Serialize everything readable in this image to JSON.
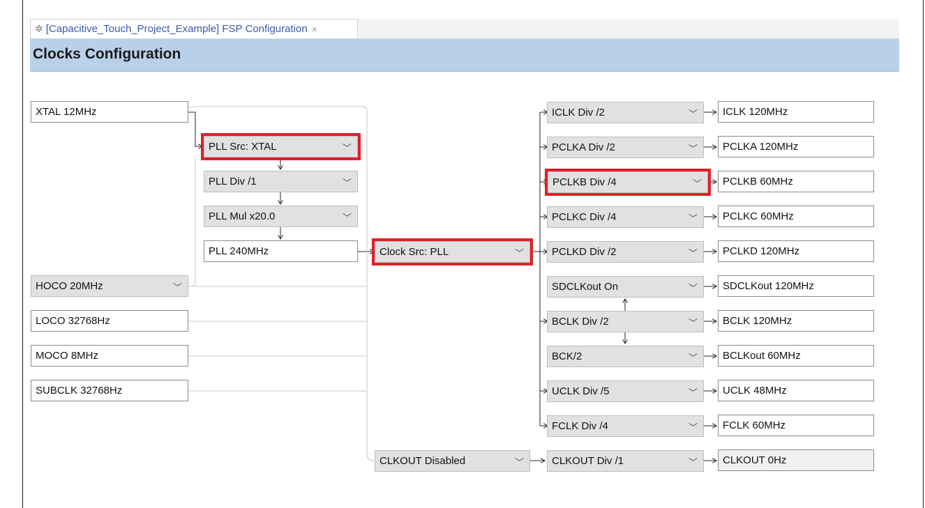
{
  "tab": {
    "title": "[Capacitive_Touch_Project_Example] FSP Configuration",
    "close": "×",
    "icon": "gear-icon"
  },
  "header": {
    "title": "Clocks Configuration"
  },
  "sources": {
    "xtal": "XTAL 12MHz",
    "hoco": "HOCO 20MHz",
    "loco": "LOCO 32768Hz",
    "moco": "MOCO 8MHz",
    "subclk": "SUBCLK 32768Hz"
  },
  "pll": {
    "src": "PLL Src: XTAL",
    "div": "PLL Div /1",
    "mul": "PLL Mul x20.0",
    "out": "PLL 240MHz"
  },
  "clock_src": "Clock Src: PLL",
  "clkout_src": "CLKOUT Disabled",
  "dividers": [
    {
      "select": "ICLK Div /2",
      "output": "ICLK 120MHz"
    },
    {
      "select": "PCLKA Div /2",
      "output": "PCLKA 120MHz"
    },
    {
      "select": "PCLKB Div /4",
      "output": "PCLKB 60MHz"
    },
    {
      "select": "PCLKC Div /4",
      "output": "PCLKC 60MHz"
    },
    {
      "select": "PCLKD Div /2",
      "output": "PCLKD 120MHz"
    },
    {
      "select": "SDCLKout On",
      "output": "SDCLKout 120MHz"
    },
    {
      "select": "BCLK Div /2",
      "output": "BCLK 120MHz"
    },
    {
      "select": "BCK/2",
      "output": "BCLKout 60MHz"
    },
    {
      "select": "UCLK Div /5",
      "output": "UCLK 48MHz"
    },
    {
      "select": "FCLK Div /4",
      "output": "FCLK 60MHz"
    },
    {
      "select": "CLKOUT Div /1",
      "output": "CLKOUT 0Hz"
    }
  ],
  "colors": {
    "highlight": "#e0202a",
    "header_bg": "#b9d0ea",
    "select_bg": "#e1e1e1"
  }
}
